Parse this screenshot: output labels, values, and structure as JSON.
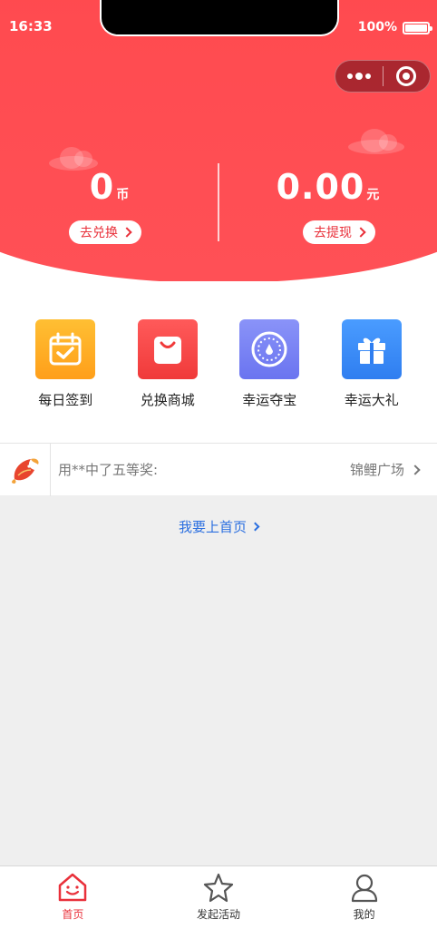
{
  "status_bar": {
    "time": "16:33",
    "battery": "100%"
  },
  "capsule": {
    "more_icon": "more-dots-icon",
    "close_icon": "target-circle-icon"
  },
  "balance": {
    "coins": {
      "value": "0",
      "unit": "币",
      "action": "去兑换"
    },
    "cash": {
      "value": "0.00",
      "unit": "元",
      "action": "去提现"
    }
  },
  "features": [
    {
      "label": "每日签到",
      "icon": "calendar-check-icon",
      "color": "#ffb12b"
    },
    {
      "label": "兑换商城",
      "icon": "shopping-bag-icon",
      "color": "#f24a4a"
    },
    {
      "label": "幸运夺宝",
      "icon": "lucky-wheel-icon",
      "color": "#7b84f7"
    },
    {
      "label": "幸运大礼",
      "icon": "gift-icon",
      "color": "#3a8cf5"
    }
  ],
  "ticker": {
    "logo": "koi-fish-icon",
    "message": "用**中了五等奖:",
    "link": "锦鲤广场"
  },
  "home_link": "我要上首页",
  "tabs": [
    {
      "label": "首页",
      "icon": "home-smile-icon",
      "active": true
    },
    {
      "label": "发起活动",
      "icon": "star-icon",
      "active": false
    },
    {
      "label": "我的",
      "icon": "user-icon",
      "active": false
    }
  ],
  "colors": {
    "primary_red": "#ff4047",
    "link_blue": "#2b6fe0",
    "background": "#efefef"
  }
}
